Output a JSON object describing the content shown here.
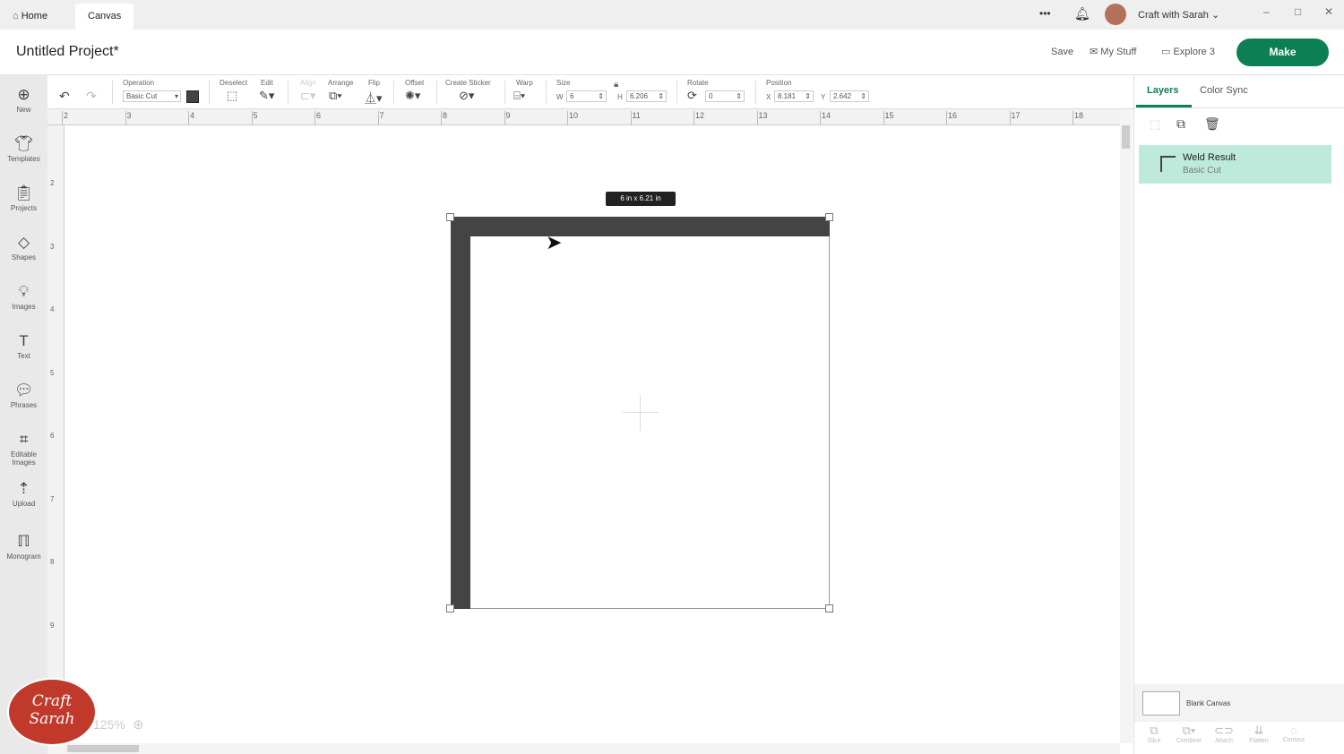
{
  "topbar": {
    "tabs": [
      "Home",
      "Canvas"
    ],
    "more": "•••",
    "user": "Craft with Sarah"
  },
  "header": {
    "title": "Untitled Project*",
    "save": "Save",
    "my_stuff": "My Stuff",
    "machine": "Explore 3",
    "make": "Make",
    "accent": "#0d7f54"
  },
  "sidebar": [
    {
      "icon": "plus-circle",
      "label": "New"
    },
    {
      "icon": "shirt",
      "label": "Templates"
    },
    {
      "icon": "clipboard",
      "label": "Projects"
    },
    {
      "icon": "shapes",
      "label": "Shapes"
    },
    {
      "icon": "bulb",
      "label": "Images"
    },
    {
      "icon": "T",
      "label": "Text"
    },
    {
      "icon": "speech",
      "label": "Phrases"
    },
    {
      "icon": "crop",
      "label": "Editable Images"
    },
    {
      "icon": "upload",
      "label": "Upload"
    },
    {
      "icon": "monogram",
      "label": "Monogram"
    }
  ],
  "toolbar": {
    "operation_label": "Operation",
    "operation_value": "Basic Cut",
    "deselect": "Deselect",
    "edit": "Edit",
    "align": "Align",
    "arrange": "Arrange",
    "flip": "Flip",
    "offset": "Offset",
    "sticker": "Create Sticker",
    "warp": "Warp",
    "size": "Size",
    "w_label": "W",
    "w": "6",
    "h_label": "H",
    "h": "6.206",
    "rotate": "Rotate",
    "rotate_value": "0",
    "position": "Position",
    "x_label": "X",
    "x": "8.181",
    "y_label": "Y",
    "y": "2.642"
  },
  "ruler": {
    "h": [
      "2",
      "3",
      "4",
      "5",
      "6",
      "7",
      "8",
      "9",
      "10",
      "11",
      "12",
      "13",
      "14",
      "15",
      "16",
      "17",
      "18"
    ],
    "v": [
      "2",
      "3",
      "4",
      "5",
      "6",
      "7",
      "8",
      "9"
    ]
  },
  "canvas": {
    "size_tooltip": "6  in x 6.21  in",
    "zoom": "125%",
    "shape_color": "#444444"
  },
  "layers": {
    "tabs": [
      "Layers",
      "Color Sync"
    ],
    "item_name": "Weld Result",
    "item_op": "Basic Cut",
    "blank": "Blank Canvas",
    "bottom": [
      "Slice",
      "Combine",
      "Attach",
      "Flatten",
      "Contour"
    ],
    "highlight": "#bdeadb"
  },
  "logo": {
    "text": "Craft with Sarah"
  }
}
